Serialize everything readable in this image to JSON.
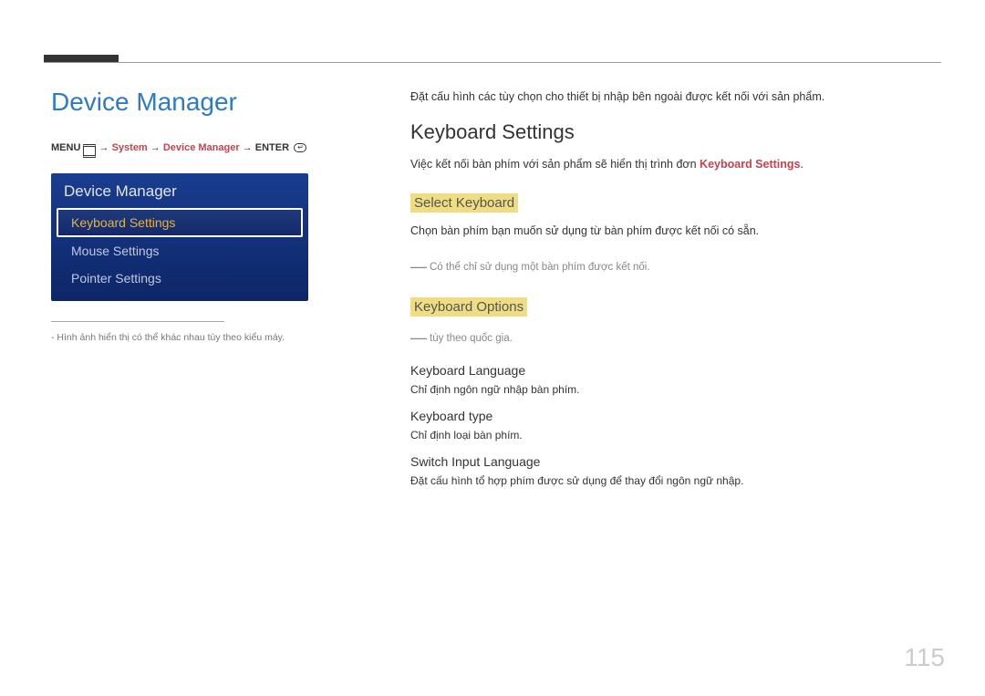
{
  "page_number": "115",
  "left": {
    "title": "Device Manager",
    "path": {
      "menu": "MENU",
      "arrow": "→",
      "system": "System",
      "device_manager": "Device Manager",
      "enter": "ENTER"
    },
    "osd": {
      "title": "Device Manager",
      "items": [
        {
          "label": "Keyboard Settings",
          "selected": true
        },
        {
          "label": "Mouse Settings",
          "selected": false
        },
        {
          "label": "Pointer Settings",
          "selected": false
        }
      ]
    },
    "note": "Hình ảnh hiển thị có thể khác nhau tùy theo kiểu máy."
  },
  "right": {
    "intro": "Đặt cấu hình các tùy chọn cho thiết bị nhập bên ngoài được kết nối với sản phẩm.",
    "section_title": "Keyboard Settings",
    "section_desc_prefix": "Việc kết nối bàn phím với sản phẩm sẽ hiển thị trình đơn ",
    "section_desc_term": "Keyboard Settings",
    "section_desc_suffix": ".",
    "select_keyboard": {
      "title": "Select Keyboard",
      "desc": "Chọn bàn phím bạn muốn sử dụng từ bàn phím được kết nối có sẵn.",
      "note": "Có thể chỉ sử dụng một bàn phím được kết nối."
    },
    "keyboard_options": {
      "title": "Keyboard Options",
      "note": "tùy theo quốc gia.",
      "items": [
        {
          "title": "Keyboard Language",
          "desc": "Chỉ định ngôn ngữ nhập bàn phím."
        },
        {
          "title": "Keyboard type",
          "desc": "Chỉ định loại bàn phím."
        },
        {
          "title": "Switch Input Language",
          "desc": "Đặt cấu hình tổ hợp phím được sử dụng để thay đổi ngôn ngữ nhập."
        }
      ]
    }
  }
}
